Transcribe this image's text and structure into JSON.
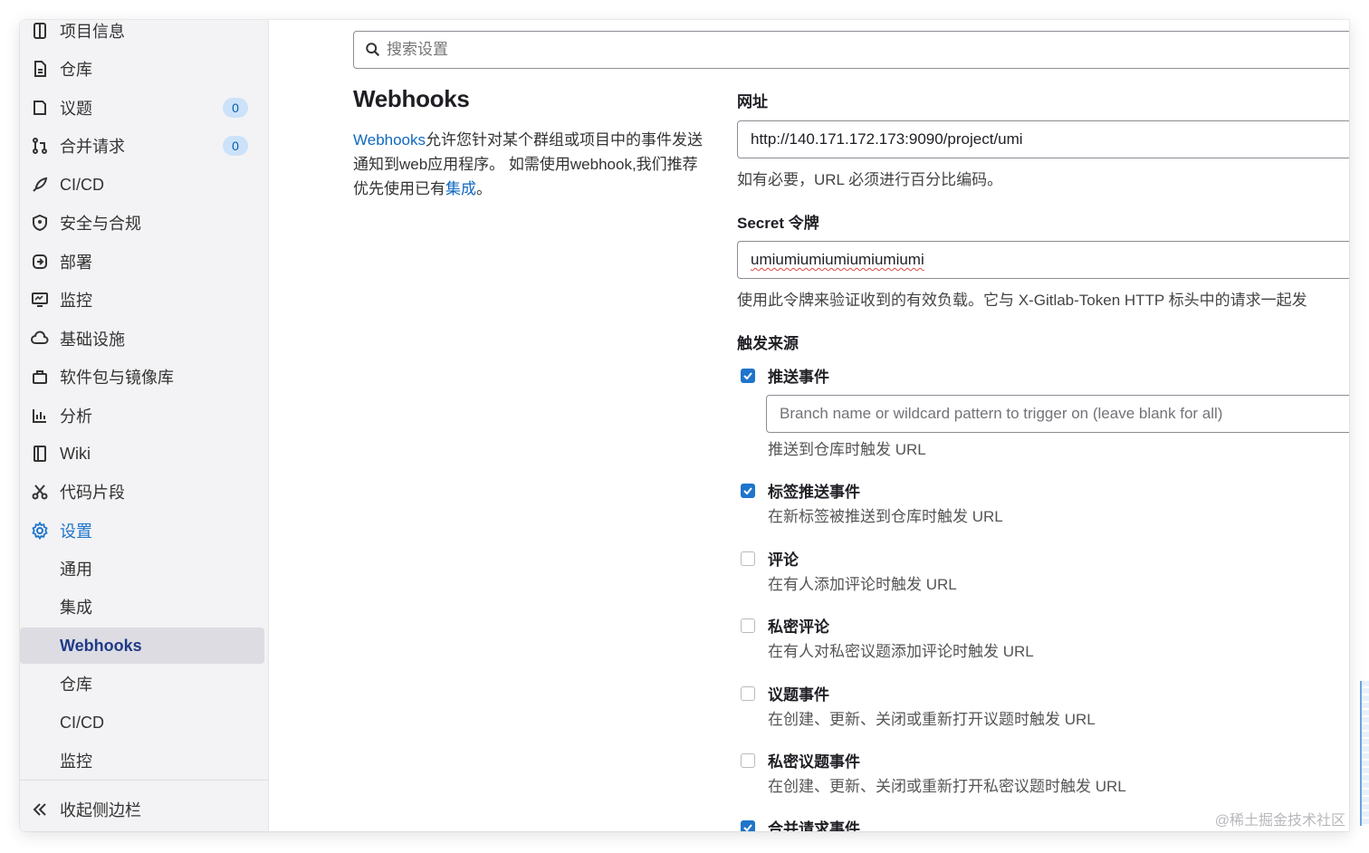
{
  "sidebar": {
    "items": [
      {
        "label": "项目信息",
        "icon": "project-icon"
      },
      {
        "label": "仓库",
        "icon": "document-icon"
      },
      {
        "label": "议题",
        "icon": "issues-icon",
        "badge": "0"
      },
      {
        "label": "合并请求",
        "icon": "merge-request-icon",
        "badge": "0"
      },
      {
        "label": "CI/CD",
        "icon": "rocket-icon"
      },
      {
        "label": "安全与合规",
        "icon": "shield-icon"
      },
      {
        "label": "部署",
        "icon": "deploy-icon"
      },
      {
        "label": "监控",
        "icon": "monitor-icon"
      },
      {
        "label": "基础设施",
        "icon": "cloud-icon"
      },
      {
        "label": "软件包与镜像库",
        "icon": "package-icon"
      },
      {
        "label": "分析",
        "icon": "chart-icon"
      },
      {
        "label": "Wiki",
        "icon": "book-icon"
      },
      {
        "label": "代码片段",
        "icon": "scissors-icon"
      },
      {
        "label": "设置",
        "icon": "gear-icon"
      }
    ],
    "settings_sub": [
      "通用",
      "集成",
      "Webhooks",
      "仓库",
      "CI/CD",
      "监控"
    ],
    "selected_sub": "Webhooks",
    "collapse_label": "收起侧边栏"
  },
  "search": {
    "placeholder": "搜索设置"
  },
  "intro": {
    "title": "Webhooks",
    "link_text": "Webhooks",
    "text1": "允许您针对某个群组或项目中的事件发送通知到web应用程序。 如需使用webhook,我们推荐优先使用已有",
    "integration_link": "集成",
    "text2": "。"
  },
  "form": {
    "url_label": "网址",
    "url_value": "http://140.171.172.173:9090/project/umi",
    "url_help": "如有必要，URL 必须进行百分比编码。",
    "secret_label": "Secret 令牌",
    "secret_value": "umiumiumiumiumiumiumi",
    "secret_help": "使用此令牌来验证收到的有效负载。它与 X-Gitlab-Token HTTP 标头中的请求一起发",
    "trigger_label": "触发来源",
    "branch_placeholder": "Branch name or wildcard pattern to trigger on (leave blank for all)",
    "triggers": [
      {
        "label": "推送事件",
        "desc": "推送到仓库时触发 URL",
        "checked": true
      },
      {
        "label": "标签推送事件",
        "desc": "在新标签被推送到仓库时触发 URL",
        "checked": true
      },
      {
        "label": "评论",
        "desc": "在有人添加评论时触发 URL",
        "checked": false
      },
      {
        "label": "私密评论",
        "desc": "在有人对私密议题添加评论时触发 URL",
        "checked": false
      },
      {
        "label": "议题事件",
        "desc": "在创建、更新、关闭或重新打开议题时触发 URL",
        "checked": false
      },
      {
        "label": "私密议题事件",
        "desc": "在创建、更新、关闭或重新打开私密议题时触发 URL",
        "checked": false
      },
      {
        "label": "合并请求事件",
        "desc": "",
        "checked": true
      }
    ]
  },
  "watermark": "@稀土掘金技术社区",
  "colors": {
    "accent": "#1f75cb",
    "link": "#1068bf",
    "sidebar_bg": "#f3f3f5"
  }
}
